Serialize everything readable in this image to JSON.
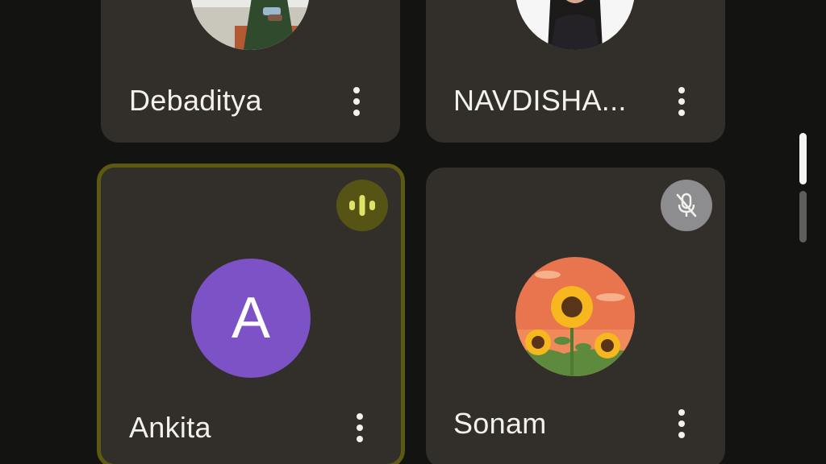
{
  "participants": [
    {
      "name": "Debaditya",
      "avatar_icon": "photo-icon",
      "state": "normal"
    },
    {
      "name": "NAVDISHA...",
      "avatar_icon": "photo-icon",
      "state": "normal"
    },
    {
      "name": "Ankita",
      "avatar_letter": "A",
      "avatar_color": "#7d52c6",
      "state": "speaking",
      "status_icon": "speaking-indicator-icon"
    },
    {
      "name": "Sonam",
      "avatar_icon": "sunflower-photo-icon",
      "state": "muted",
      "status_icon": "mic-off-icon"
    }
  ],
  "colors": {
    "background": "#131311",
    "tile": "#322f2b",
    "speaking_border": "#5b5a10",
    "speaking_badge": "#555415",
    "speaking_bars": "#dfe26a",
    "muted_badge": "#8d8c8f"
  }
}
